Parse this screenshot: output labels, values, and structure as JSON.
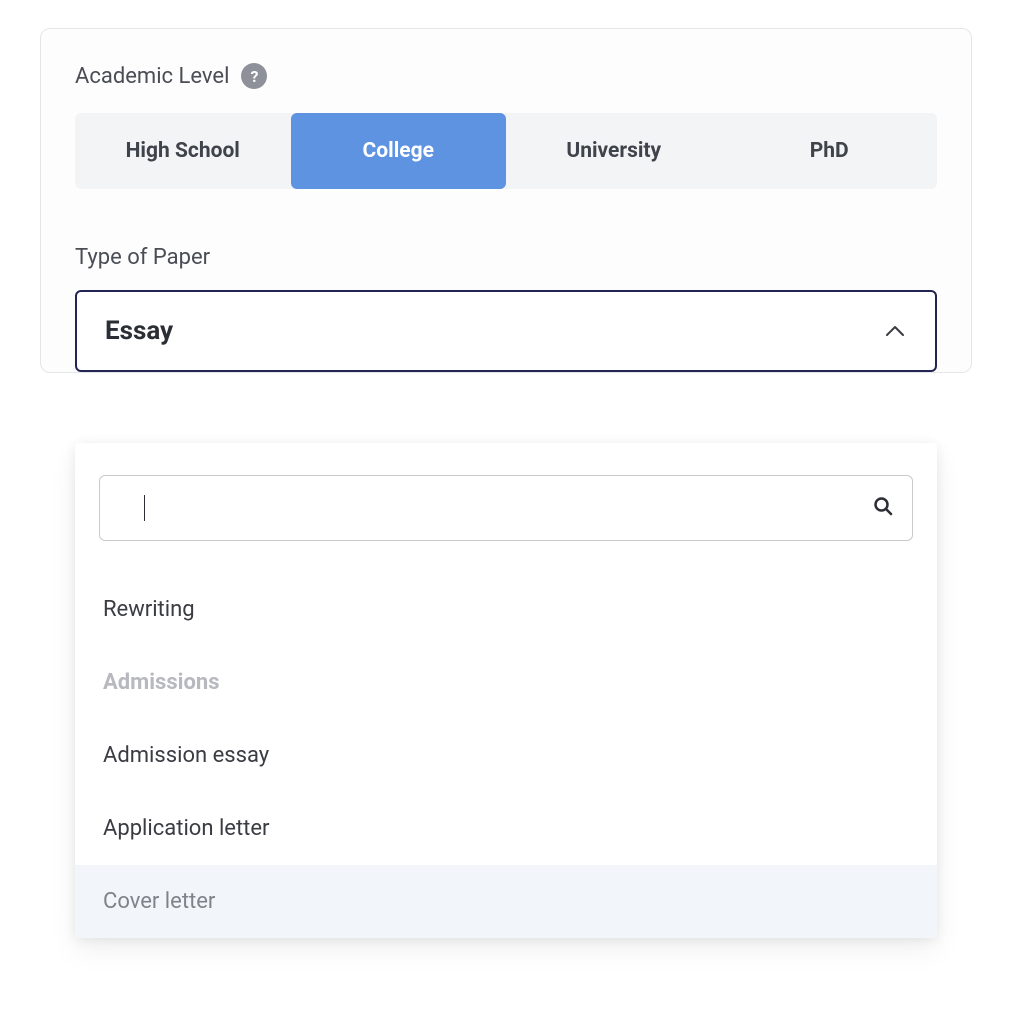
{
  "academic_level": {
    "label": "Academic Level",
    "help_glyph": "?",
    "options": [
      "High School",
      "College",
      "University",
      "PhD"
    ],
    "active_index": 1
  },
  "paper_type": {
    "label": "Type of Paper",
    "selected": "Essay",
    "search_value": "",
    "dropdown": {
      "items": [
        {
          "text": "Rewriting",
          "kind": "item",
          "hover": false
        },
        {
          "text": "Admissions",
          "kind": "group",
          "hover": false
        },
        {
          "text": "Admission essay",
          "kind": "item",
          "hover": false
        },
        {
          "text": "Application letter",
          "kind": "item",
          "hover": false
        },
        {
          "text": "Cover letter",
          "kind": "item",
          "hover": true
        }
      ]
    }
  }
}
